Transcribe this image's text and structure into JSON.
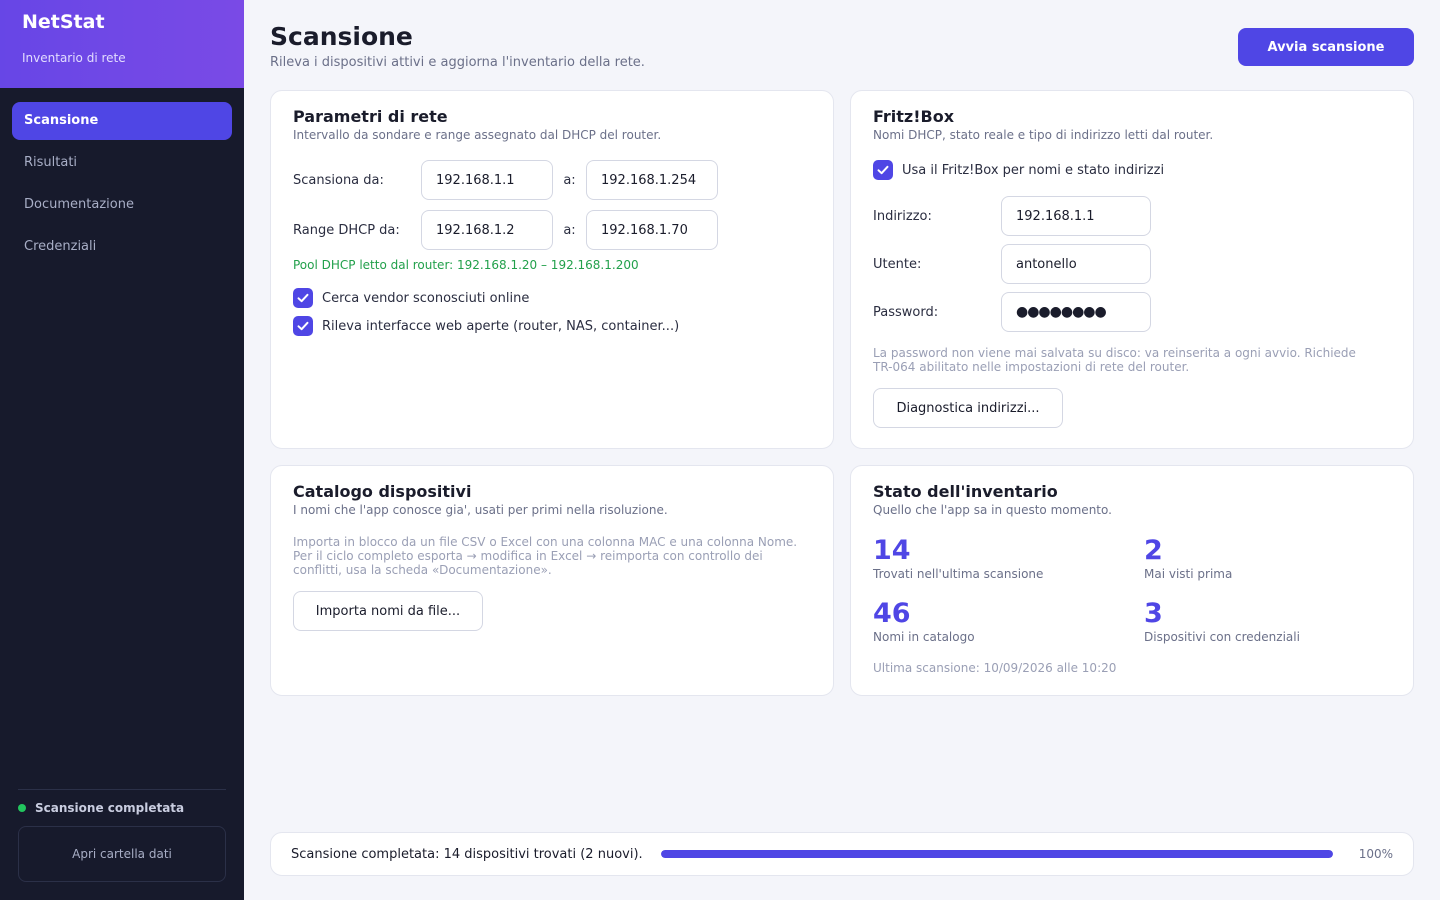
{
  "app": {
    "name": "NetStat",
    "subtitle": "Inventario di rete"
  },
  "sidebar": {
    "items": [
      {
        "label": "Scansione",
        "active": true
      },
      {
        "label": "Risultati",
        "active": false
      },
      {
        "label": "Documentazione",
        "active": false
      },
      {
        "label": "Credenziali",
        "active": false
      }
    ],
    "status": {
      "text": "Scansione completata",
      "color": "#22c55e"
    },
    "open_folder": "Apri cartella dati"
  },
  "header": {
    "title": "Scansione",
    "subtitle": "Rileva i dispositivi attivi e aggiorna l'inventario della rete.",
    "start_button": "Avvia scansione"
  },
  "network": {
    "title": "Parametri di rete",
    "subtitle": "Intervallo da sondare e range assegnato dal DHCP del router.",
    "scan_label": "Scansiona da:",
    "scan_from": "192.168.1.1",
    "to_label": "a:",
    "scan_to": "192.168.1.254",
    "dhcp_label": "Range DHCP da:",
    "dhcp_from": "192.168.1.2",
    "dhcp_to": "192.168.1.70",
    "pool_note": "Pool DHCP letto dal router: 192.168.1.20 – 192.168.1.200",
    "check_vendor": "Cerca vendor sconosciuti online",
    "check_web": "Rileva interfacce web aperte (router, NAS, container...)"
  },
  "fritzbox": {
    "title": "Fritz!Box",
    "subtitle": "Nomi DHCP, stato reale e tipo di indirizzo letti dal router.",
    "use_check": "Usa il Fritz!Box per nomi e stato indirizzi",
    "address_label": "Indirizzo:",
    "address": "192.168.1.1",
    "user_label": "Utente:",
    "user": "antonello",
    "password_label": "Password:",
    "password": "●●●●●●●●",
    "note_line1": "La password non viene mai salvata su disco: va reinserita a ogni avvio. Richiede",
    "note_line2": "TR-064 abilitato nelle impostazioni di rete del router.",
    "diag_button": "Diagnostica indirizzi..."
  },
  "catalog": {
    "title": "Catalogo dispositivi",
    "subtitle": "I nomi che l'app conosce gia', usati per primi nella risoluzione.",
    "note_line1": "Importa in blocco da un file CSV o Excel con una colonna MAC e una colonna Nome.",
    "note_line2": "Per il ciclo completo esporta → modifica in Excel → reimporta con controllo dei",
    "note_line3": "conflitti, usa la scheda «Documentazione».",
    "import_button": "Importa nomi da file..."
  },
  "inventory": {
    "title": "Stato dell'inventario",
    "subtitle": "Quello che l'app sa in questo momento.",
    "stats": [
      {
        "value": "14",
        "label": "Trovati nell'ultima scansione"
      },
      {
        "value": "2",
        "label": "Mai visti prima"
      },
      {
        "value": "46",
        "label": "Nomi in catalogo"
      },
      {
        "value": "3",
        "label": "Dispositivi con credenziali"
      }
    ],
    "last_scan": "Ultima scansione: 10/09/2026 alle 10:20"
  },
  "footer": {
    "status": "Scansione completata: 14 dispositivi trovati (2 nuovi).",
    "progress": 100,
    "progress_label": "100%"
  }
}
